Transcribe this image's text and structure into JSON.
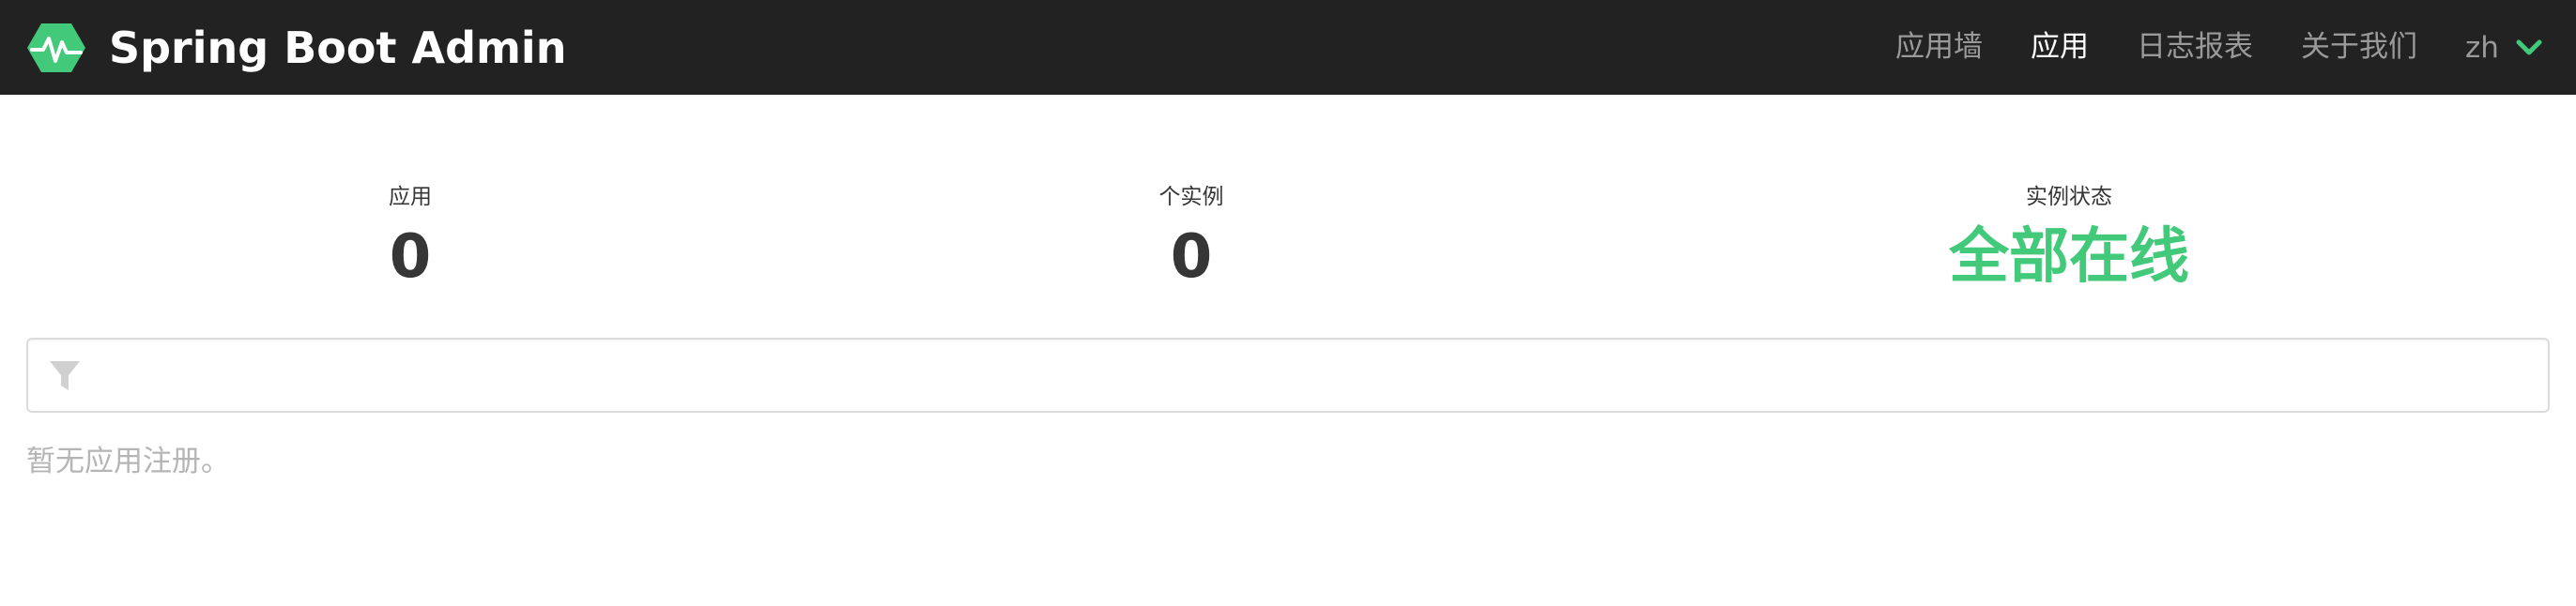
{
  "app": {
    "title": "Spring Boot Admin",
    "logo_icon": "heartbeat-hexagon-icon",
    "brand_color": "#42c97a"
  },
  "nav": {
    "items": [
      {
        "label": "应用墙",
        "active": false
      },
      {
        "label": "应用",
        "active": true
      },
      {
        "label": "日志报表",
        "active": false
      },
      {
        "label": "关于我们",
        "active": false
      }
    ],
    "language": {
      "label": "zh",
      "icon": "chevron-down-icon"
    }
  },
  "stats": {
    "applications": {
      "label": "应用",
      "value": "0"
    },
    "instances": {
      "label": "个实例",
      "value": "0"
    },
    "status": {
      "label": "实例状态",
      "value": "全部在线",
      "color": "#42c97a"
    }
  },
  "filter": {
    "icon": "filter-icon",
    "value": "",
    "placeholder": ""
  },
  "empty_message": "暂无应用注册。"
}
